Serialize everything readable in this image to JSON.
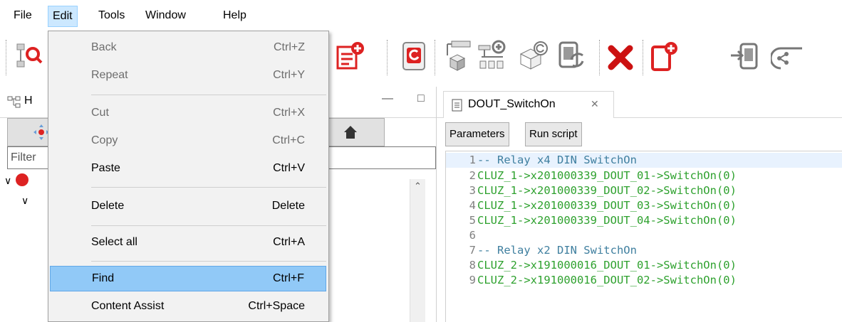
{
  "menubar": {
    "items": [
      "File",
      "Edit",
      "Tools",
      "Window",
      "Help"
    ]
  },
  "left_panel": {
    "title_fragment": "H",
    "filter_placeholder": "Filter"
  },
  "editor": {
    "tab_label": "DOUT_SwitchOn",
    "buttons": [
      "Parameters",
      "Run script"
    ],
    "lines": [
      {
        "n": "1",
        "text": "-- Relay x4 DIN SwitchOn",
        "kind": "comment"
      },
      {
        "n": "2",
        "text": "CLUZ_1->x201000339_DOUT_01->SwitchOn(0)",
        "kind": "code"
      },
      {
        "n": "3",
        "text": "CLUZ_1->x201000339_DOUT_02->SwitchOn(0)",
        "kind": "code"
      },
      {
        "n": "4",
        "text": "CLUZ_1->x201000339_DOUT_03->SwitchOn(0)",
        "kind": "code"
      },
      {
        "n": "5",
        "text": "CLUZ_1->x201000339_DOUT_04->SwitchOn(0)",
        "kind": "code"
      },
      {
        "n": "6",
        "text": "",
        "kind": "code"
      },
      {
        "n": "7",
        "text": "-- Relay x2 DIN SwitchOn",
        "kind": "comment"
      },
      {
        "n": "8",
        "text": "CLUZ_2->x191000016_DOUT_01->SwitchOn(0)",
        "kind": "code"
      },
      {
        "n": "9",
        "text": "CLUZ_2->x191000016_DOUT_02->SwitchOn(0)",
        "kind": "code"
      }
    ]
  },
  "edit_menu": {
    "items": [
      {
        "label": "Back",
        "shortcut": "Ctrl+Z",
        "enabled": false
      },
      {
        "label": "Repeat",
        "shortcut": "Ctrl+Y",
        "enabled": false
      },
      {
        "label": "Cut",
        "shortcut": "Ctrl+X",
        "enabled": false
      },
      {
        "label": "Copy",
        "shortcut": "Ctrl+C",
        "enabled": false
      },
      {
        "label": "Paste",
        "shortcut": "Ctrl+V",
        "enabled": true
      },
      {
        "label": "Delete",
        "shortcut": "Delete",
        "enabled": true
      },
      {
        "label": "Select all",
        "shortcut": "Ctrl+A",
        "enabled": true
      },
      {
        "label": "Find",
        "shortcut": "Ctrl+F",
        "enabled": true,
        "selected": true
      },
      {
        "label": "Content Assist",
        "shortcut": "Ctrl+Space",
        "enabled": true
      }
    ]
  },
  "colors": {
    "menu_highlight": "#91c9f7",
    "code_green": "#2ea12e",
    "comment_blue": "#3f7f9f",
    "active_menu": "#cce8ff"
  },
  "toolbar_icons": [
    "tree-search-icon",
    "script-add-icon",
    "cycle-icon",
    "cube-network-icon",
    "add-network-icon",
    "cube-refresh-icon",
    "device-sync-icon",
    "delete-x-icon",
    "object-add-icon",
    "device-import-icon",
    "cloud-share-icon"
  ]
}
